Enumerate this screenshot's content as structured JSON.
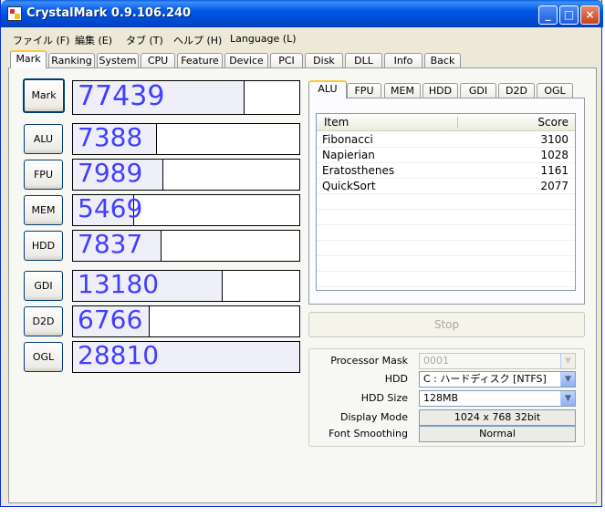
{
  "window": {
    "title": "CrystalMark 0.9.106.240",
    "controls": [
      "_",
      "□",
      "×"
    ]
  },
  "menu": [
    "ファイル (F)",
    "編集 (E)",
    "タブ (T)",
    "ヘルプ (H)",
    "Language (L)"
  ],
  "tabs": [
    "Mark",
    "Ranking",
    "System",
    "CPU",
    "Feature",
    "Device",
    "PCI",
    "Disk",
    "DLL",
    "Info",
    "Back"
  ],
  "active_tab": "Mark",
  "marks": [
    {
      "label": "Mark",
      "score": "77439",
      "fill": 0.76
    },
    {
      "label": "ALU",
      "score": "7388",
      "fill": 0.37
    },
    {
      "label": "FPU",
      "score": "7989",
      "fill": 0.4
    },
    {
      "label": "MEM",
      "score": "5469",
      "fill": 0.27
    },
    {
      "label": "HDD",
      "score": "7837",
      "fill": 0.39
    },
    {
      "label": "GDI",
      "score": "13180",
      "fill": 0.66
    },
    {
      "label": "D2D",
      "score": "6766",
      "fill": 0.34
    },
    {
      "label": "OGL",
      "score": "28810",
      "fill": 1.0
    }
  ],
  "subtabs": [
    "ALU",
    "FPU",
    "MEM",
    "HDD",
    "GDI",
    "D2D",
    "OGL"
  ],
  "active_subtab": "ALU",
  "table": {
    "headers": [
      "Item",
      "Score"
    ],
    "rows": [
      [
        "Fibonacci",
        "3100"
      ],
      [
        "Napierian",
        "1028"
      ],
      [
        "Eratosthenes",
        "1161"
      ],
      [
        "QuickSort",
        "2077"
      ]
    ]
  },
  "stop_label": "Stop",
  "settings": {
    "processor_mask_label": "Processor Mask",
    "processor_mask_value": "0001",
    "hdd_label": "HDD",
    "hdd_value": "C : ハードディスク [NTFS]",
    "hdd_size_label": "HDD Size",
    "hdd_size_value": "128MB",
    "display_mode_label": "Display Mode",
    "display_mode_value": "1024 x 768 32bit",
    "font_smoothing_label": "Font Smoothing",
    "font_smoothing_value": "Normal"
  },
  "colors": {
    "titlebar": "#0058e6",
    "score_text": "#4040ff",
    "score_fill": "#efeffa",
    "window_bg": "#ece9d8"
  }
}
